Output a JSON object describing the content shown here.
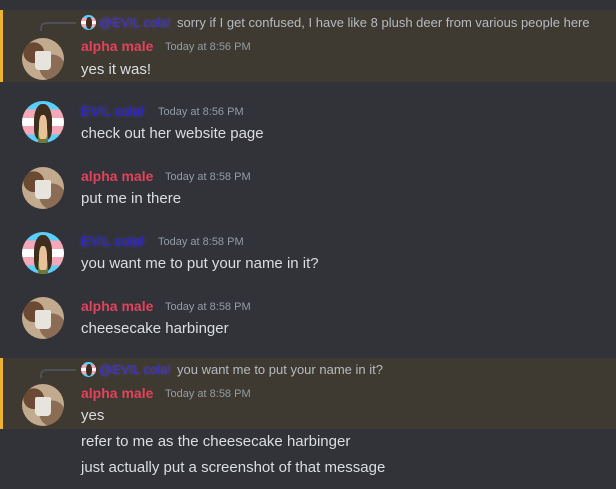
{
  "messages": [
    {
      "author": "alpha male",
      "time": "Today at 8:56 PM",
      "reply": {
        "author": "@EVIL cola!",
        "text": "sorry if I get confused, I have like 8 plush deer from various people here"
      },
      "lines": [
        "yes it was!"
      ]
    },
    {
      "author": "EVIL cola!",
      "time": "Today at 8:56 PM",
      "lines": [
        "check out her website page"
      ]
    },
    {
      "author": "alpha male",
      "time": "Today at 8:58 PM",
      "lines": [
        "put me in there"
      ]
    },
    {
      "author": "EVIL cola!",
      "time": "Today at 8:58 PM",
      "lines": [
        "you want me to put your name in it?"
      ]
    },
    {
      "author": "alpha male",
      "time": "Today at 8:58 PM",
      "lines": [
        "cheesecake harbinger"
      ]
    },
    {
      "author": "alpha male",
      "time": "Today at 8:58 PM",
      "reply": {
        "author": "@EVIL cola!",
        "text": "you want me to put your name in it?"
      },
      "lines": [
        "yes",
        "refer to me as the cheesecake harbinger",
        "just actually put a screenshot of that message"
      ]
    }
  ]
}
